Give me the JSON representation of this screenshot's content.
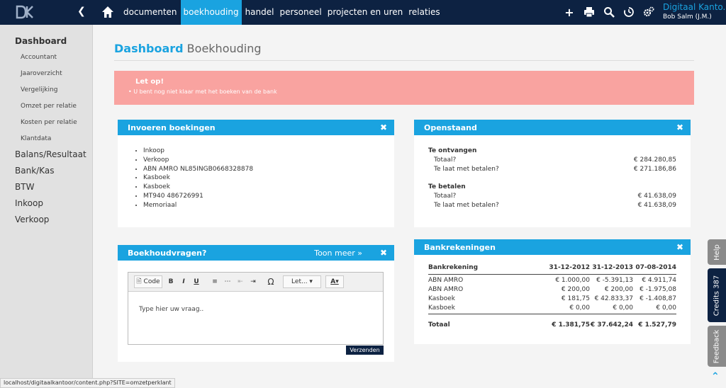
{
  "header": {
    "nav": [
      "documenten",
      "boekhouding",
      "handel",
      "personeel",
      "projecten en uren",
      "relaties"
    ],
    "active_nav": "boekhouding",
    "user_app": "Digitaal Kanto..",
    "user_name": "Bob Salm (J.M.)"
  },
  "sidebar": {
    "dashboard": "Dashboard",
    "sub_items": [
      "Accountant",
      "Jaaroverzicht",
      "Vergelijking",
      "Omzet per relatie",
      "Kosten per relatie",
      "Klantdata"
    ],
    "main_items": [
      "Balans/Resultaat",
      "Bank/Kas",
      "BTW",
      "Inkoop",
      "Verkoop"
    ]
  },
  "page": {
    "title_strong": "Dashboard",
    "title_rest": "Boekhouding"
  },
  "alert": {
    "title": "Let op!",
    "message": "U bent nog niet klaar met het boeken van de bank"
  },
  "invoeren": {
    "title": "Invoeren boekingen",
    "items": [
      "Inkoop",
      "Verkoop",
      "ABN AMRO NL85INGB0668328878",
      "Kasboek",
      "Kasboek",
      "MT940 486726991",
      "Memoriaal"
    ]
  },
  "openstaand": {
    "title": "Openstaand",
    "ontvangen_title": "Te ontvangen",
    "betalen_title": "Te betalen",
    "totaal_label": "Totaal?",
    "laat_label": "Te laat met betalen?",
    "ontvangen_totaal": "€ 284.280,85",
    "ontvangen_laat": "€ 271.186,86",
    "betalen_totaal": "€ 41.638,09",
    "betalen_laat": "€ 41.638,09"
  },
  "vragen": {
    "title": "Boekhoudvragen?",
    "more": "Toon meer »",
    "toolbar_code": "Code",
    "toolbar_font": "Let...",
    "placeholder": "Type hier uw vraag..",
    "send": "Verzenden"
  },
  "bank": {
    "title": "Bankrekeningen",
    "headers": [
      "Bankrekening",
      "31-12-2012",
      "31-12-2013",
      "07-08-2014"
    ],
    "rows": [
      [
        "ABN AMRO",
        "€ 1.000,00",
        "€ -5.391,13",
        "€ 4.911,74"
      ],
      [
        "ABN AMRO",
        "€ 200,00",
        "€ 200,00",
        "€ -1.975,08"
      ],
      [
        "Kasboek",
        "€ 181,75",
        "€ 42.833,37",
        "€ -1.408,87"
      ],
      [
        "Kasboek",
        "€ 0,00",
        "€ 0,00",
        "€ 0,00"
      ]
    ],
    "total": [
      "Totaal",
      "€ 1.381,75",
      "€ 37.642,24",
      "€ 1.527,79"
    ]
  },
  "right_tabs": {
    "help": "Help",
    "credits": "Credits 387",
    "feedback": "Feedback"
  },
  "status_url": "localhost/digitaalkantoor/content.php?SITE=omzetperklant",
  "colors": {
    "navy": "#0d2242",
    "accent": "#1aa3e0",
    "alert": "#f9a3a0"
  }
}
